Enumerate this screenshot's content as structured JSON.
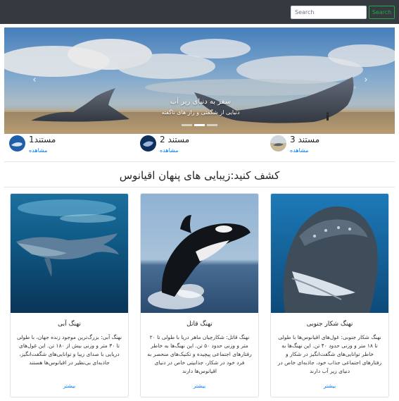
{
  "navbar": {
    "search_placeholder": "Search",
    "search_button": "Search"
  },
  "carousel": {
    "title": "سفر به دنیای زیر آب",
    "subtitle": "دنیایی از شگفتی و راز های ناگفته",
    "prev_icon": "‹",
    "next_icon": "›",
    "indicators": 3,
    "active_indicator": 2
  },
  "documentaries": [
    {
      "title": "مستند1",
      "link": "مشاهده"
    },
    {
      "title": "مستند 2",
      "link": "مشاهده"
    },
    {
      "title": "مستند 3",
      "link": "مشاهده"
    }
  ],
  "section": {
    "title": "کشف کنید:زیبایی های پنهان اقیانوس"
  },
  "cards": [
    {
      "title": "نهنگ آبی",
      "text": "نهنگ آبی: بزرگ‌ترین موجود زنده جهان، با طولی تا ۳۰ متر و وزنی بیش از ۱۸۰ تن. این غول‌های دریایی با صدای زیبا و توانایی‌های شگفت‌انگیز، جاذبه‌ای بی‌نظیر در اقیانوس‌ها هستند",
      "link": "بیشتر"
    },
    {
      "title": "نهنگ قاتل",
      "text": "نهنگ قاتل: شکارچیان ماهر دریا با طولی تا ۲۰ متر و وزنی حدود ۵۰ تن. این نهنگ‌ها به خاطر رفتارهای اجتماعی پیچیده و تکنیک‌های منحصر به فرد خود در شکار، جذابیتی خاص در دنیای اقیانوس‌ها دارند",
      "link": "بیشتر"
    },
    {
      "title": "نهنگ شکار جنوبی",
      "text": "نهنگ شکار جنوبی: غول‌های اقیانوس‌ها با طولی تا ۱۸ متر و وزنی حدود ۴۰ تن. این نهنگ‌ها به خاطر توانایی‌های شگفت‌انگیز در شکار و رفتارهای اجتماعی جذاب خود، جاذبه‌ای خاص در دنیای زیر آب دارند",
      "link": "بیشتر"
    }
  ],
  "colors": {
    "navbar_bg": "#343a40",
    "search_button": "#28a745",
    "link": "#007bff"
  }
}
